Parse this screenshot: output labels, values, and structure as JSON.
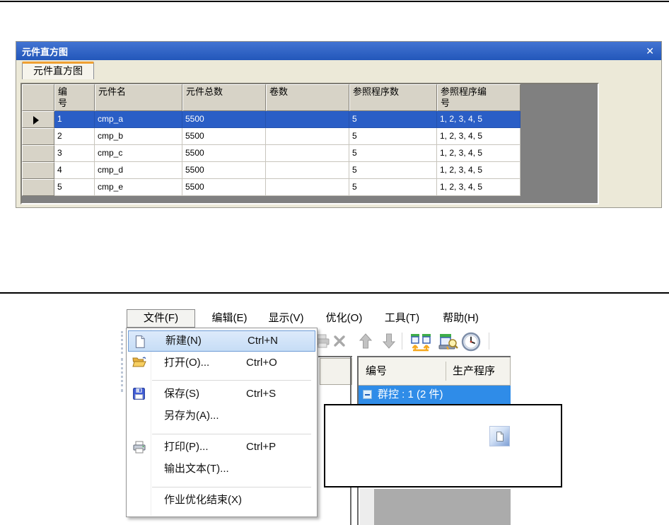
{
  "dialog": {
    "title": "元件直方图",
    "close_glyph": "✕",
    "tab_label": "元件直方图",
    "grid": {
      "columns": [
        "",
        "编号",
        "元件名",
        "元件总数",
        "卷数",
        "参照程序数",
        "参照程序编号"
      ],
      "rows": [
        [
          "1",
          "cmp_a",
          "5500",
          "",
          "5",
          "1, 2, 3, 4, 5"
        ],
        [
          "2",
          "cmp_b",
          "5500",
          "",
          "5",
          "1, 2, 3, 4, 5"
        ],
        [
          "3",
          "cmp_c",
          "5500",
          "",
          "5",
          "1, 2, 3, 4, 5"
        ],
        [
          "4",
          "cmp_d",
          "5500",
          "",
          "5",
          "1, 2, 3, 4, 5"
        ],
        [
          "5",
          "cmp_e",
          "5500",
          "",
          "5",
          "1, 2, 3, 4, 5"
        ]
      ],
      "selected_row_index": 0
    }
  },
  "menubar": {
    "items": [
      {
        "label": "文件(F)",
        "open": true
      },
      {
        "label": "编辑(E)"
      },
      {
        "label": "显示(V)"
      },
      {
        "label": "优化(O)"
      },
      {
        "label": "工具(T)"
      },
      {
        "label": "帮助(H)"
      }
    ]
  },
  "file_menu": {
    "items": [
      {
        "label": "新建(N)",
        "shortcut": "Ctrl+N",
        "icon": "new-document-icon",
        "highlighted": true
      },
      {
        "label": "打开(O)...",
        "shortcut": "Ctrl+O",
        "icon": "open-folder-icon"
      },
      {
        "label": "保存(S)",
        "shortcut": "Ctrl+S",
        "icon": "save-icon"
      },
      {
        "label": "另存为(A)...",
        "shortcut": ""
      },
      {
        "label": "打印(P)...",
        "shortcut": "Ctrl+P",
        "icon": "print-icon"
      },
      {
        "label": "输出文本(T)...",
        "shortcut": ""
      },
      {
        "label": "作业优化结束(X)",
        "shortcut": ""
      }
    ]
  },
  "toolbar": {
    "icons": [
      "print-preview-icon-disabled",
      "delete-icon",
      "move-up-icon",
      "move-down-icon",
      "machine-group-icon",
      "machine-optimize-icon",
      "clock-icon"
    ]
  },
  "right_panel": {
    "columns": [
      "编号",
      "生产程序"
    ],
    "tree_item": "群控 : 1 (2 件)"
  },
  "callout": {
    "icon": "new-document-icon"
  },
  "colors": {
    "titlebar_blue": "#2f63c8",
    "grid_selection_blue": "#2a5ec6",
    "tree_selection_blue": "#2f8ce8",
    "menu_highlight_blue": "#cfe3fa",
    "grid_filler_gray": "#808080",
    "tab_accent_orange": "#ef9f31"
  }
}
